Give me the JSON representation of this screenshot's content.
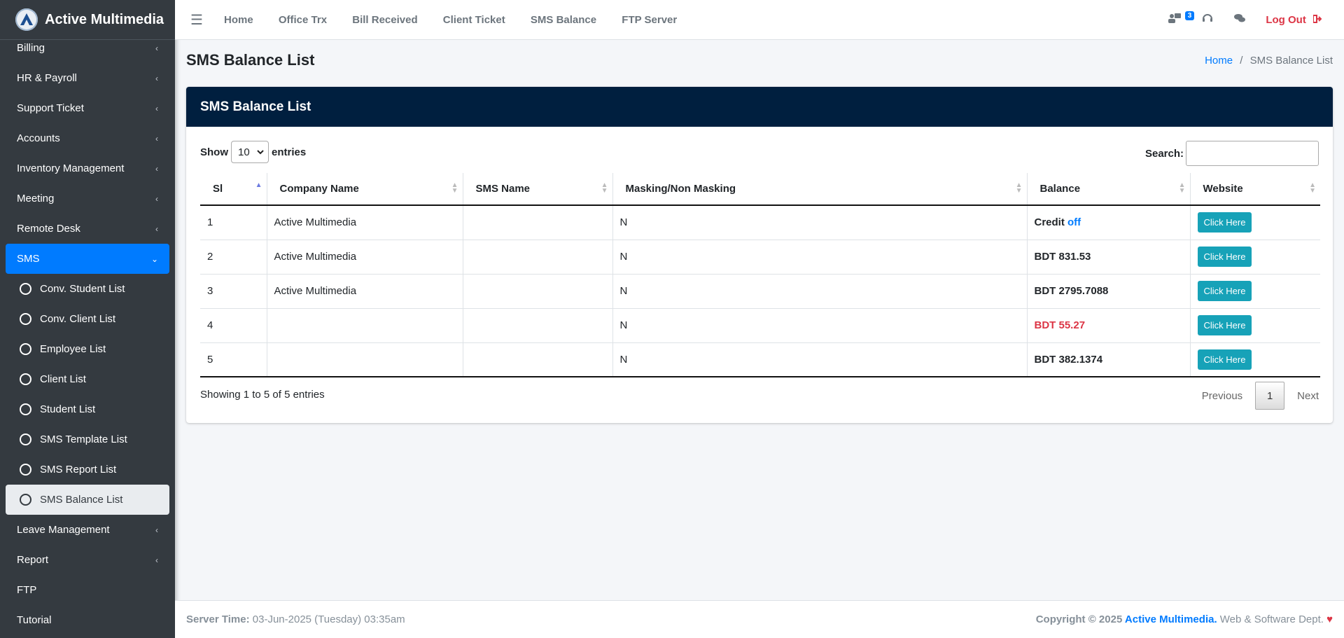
{
  "brand": {
    "name": "Active Multimedia"
  },
  "sidebar": {
    "items": [
      {
        "label": "Billing",
        "chev": "‹"
      },
      {
        "label": "HR & Payroll",
        "chev": "‹"
      },
      {
        "label": "Support Ticket",
        "chev": "‹"
      },
      {
        "label": "Accounts",
        "chev": "‹"
      },
      {
        "label": "Inventory Management",
        "chev": "‹"
      },
      {
        "label": "Meeting",
        "chev": "‹"
      },
      {
        "label": "Remote Desk",
        "chev": "‹"
      },
      {
        "label": "SMS",
        "chev": "⌄"
      }
    ],
    "sub": [
      {
        "label": "Conv. Student List"
      },
      {
        "label": "Conv. Client List"
      },
      {
        "label": "Employee List"
      },
      {
        "label": "Client List"
      },
      {
        "label": "Student List"
      },
      {
        "label": "SMS Template List"
      },
      {
        "label": "SMS Report List"
      },
      {
        "label": "SMS Balance List"
      }
    ],
    "after": [
      {
        "label": "Leave Management",
        "chev": "‹"
      },
      {
        "label": "Report",
        "chev": "‹"
      },
      {
        "label": "FTP"
      },
      {
        "label": "Tutorial"
      }
    ]
  },
  "topnav": {
    "hamburger": "☰",
    "links": [
      "Home",
      "Office Trx",
      "Bill Received",
      "Client Ticket",
      "SMS Balance",
      "FTP Server"
    ],
    "badge": "3",
    "logout": "Log Out"
  },
  "page": {
    "title": "SMS Balance List",
    "breadcrumb_home": "Home",
    "breadcrumb_sep": "/",
    "breadcrumb_current": "SMS Balance List"
  },
  "card": {
    "title": "SMS Balance List",
    "show_label": "Show",
    "entries_label": "entries",
    "page_size": "10",
    "search_label": "Search:",
    "search_value": ""
  },
  "table": {
    "headers": [
      "Sl",
      "Company Name",
      "SMS Name",
      "Masking/Non Masking",
      "Balance",
      "Website"
    ],
    "rows": [
      {
        "sl": "1",
        "company": "Active Multimedia",
        "sms": "",
        "masking": "N",
        "bal_prefix": "Credit ",
        "bal_hl": "off",
        "balance": "",
        "button": "Click Here"
      },
      {
        "sl": "2",
        "company": "Active Multimedia",
        "sms": "",
        "masking": "N",
        "bal_prefix": "",
        "bal_hl": "",
        "balance": "BDT 831.53",
        "button": "Click Here"
      },
      {
        "sl": "3",
        "company": "Active Multimedia",
        "sms": "",
        "masking": "N",
        "bal_prefix": "",
        "bal_hl": "",
        "balance": "BDT 2795.7088",
        "button": "Click Here"
      },
      {
        "sl": "4",
        "company": "",
        "sms": "",
        "masking": "N",
        "bal_prefix": "",
        "bal_hl": "",
        "balance": "BDT 55.27",
        "button": "Click Here"
      },
      {
        "sl": "5",
        "company": "",
        "sms": "",
        "masking": "N",
        "bal_prefix": "",
        "bal_hl": "",
        "balance": "BDT 382.1374",
        "button": "Click Here"
      }
    ],
    "info": "Showing 1 to 5 of 5 entries",
    "prev": "Previous",
    "page": "1",
    "next": "Next"
  },
  "footer": {
    "server_label": "Server Time:",
    "server_time": " 03-Jun-2025 (Tuesday) 03:35am",
    "copyright": "Copyright © 2025 ",
    "company": "Active Multimedia.",
    "dept": " Web & Software Dept. ",
    "heart": "♥"
  },
  "colors": {
    "accent": "#007bff",
    "header_dark": "#001f3f",
    "sidebar": "#343a40",
    "danger": "#dc3545",
    "info": "#17a2b8"
  }
}
